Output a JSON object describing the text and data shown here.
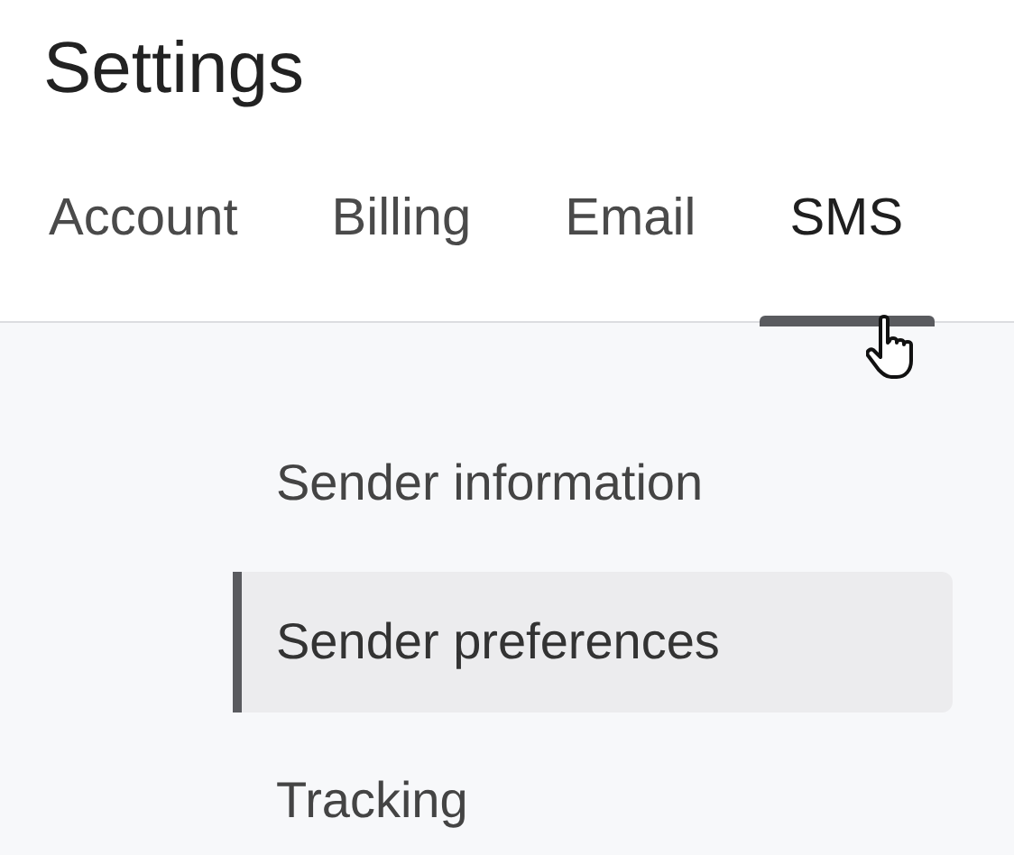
{
  "title": "Settings",
  "tabs": [
    {
      "label": "Account",
      "selected": false
    },
    {
      "label": "Billing",
      "selected": false
    },
    {
      "label": "Email",
      "selected": false
    },
    {
      "label": "SMS",
      "selected": true
    }
  ],
  "menu": [
    {
      "label": "Sender information",
      "selected": false
    },
    {
      "label": "Sender preferences",
      "selected": true
    },
    {
      "label": "Tracking",
      "selected": false
    }
  ]
}
